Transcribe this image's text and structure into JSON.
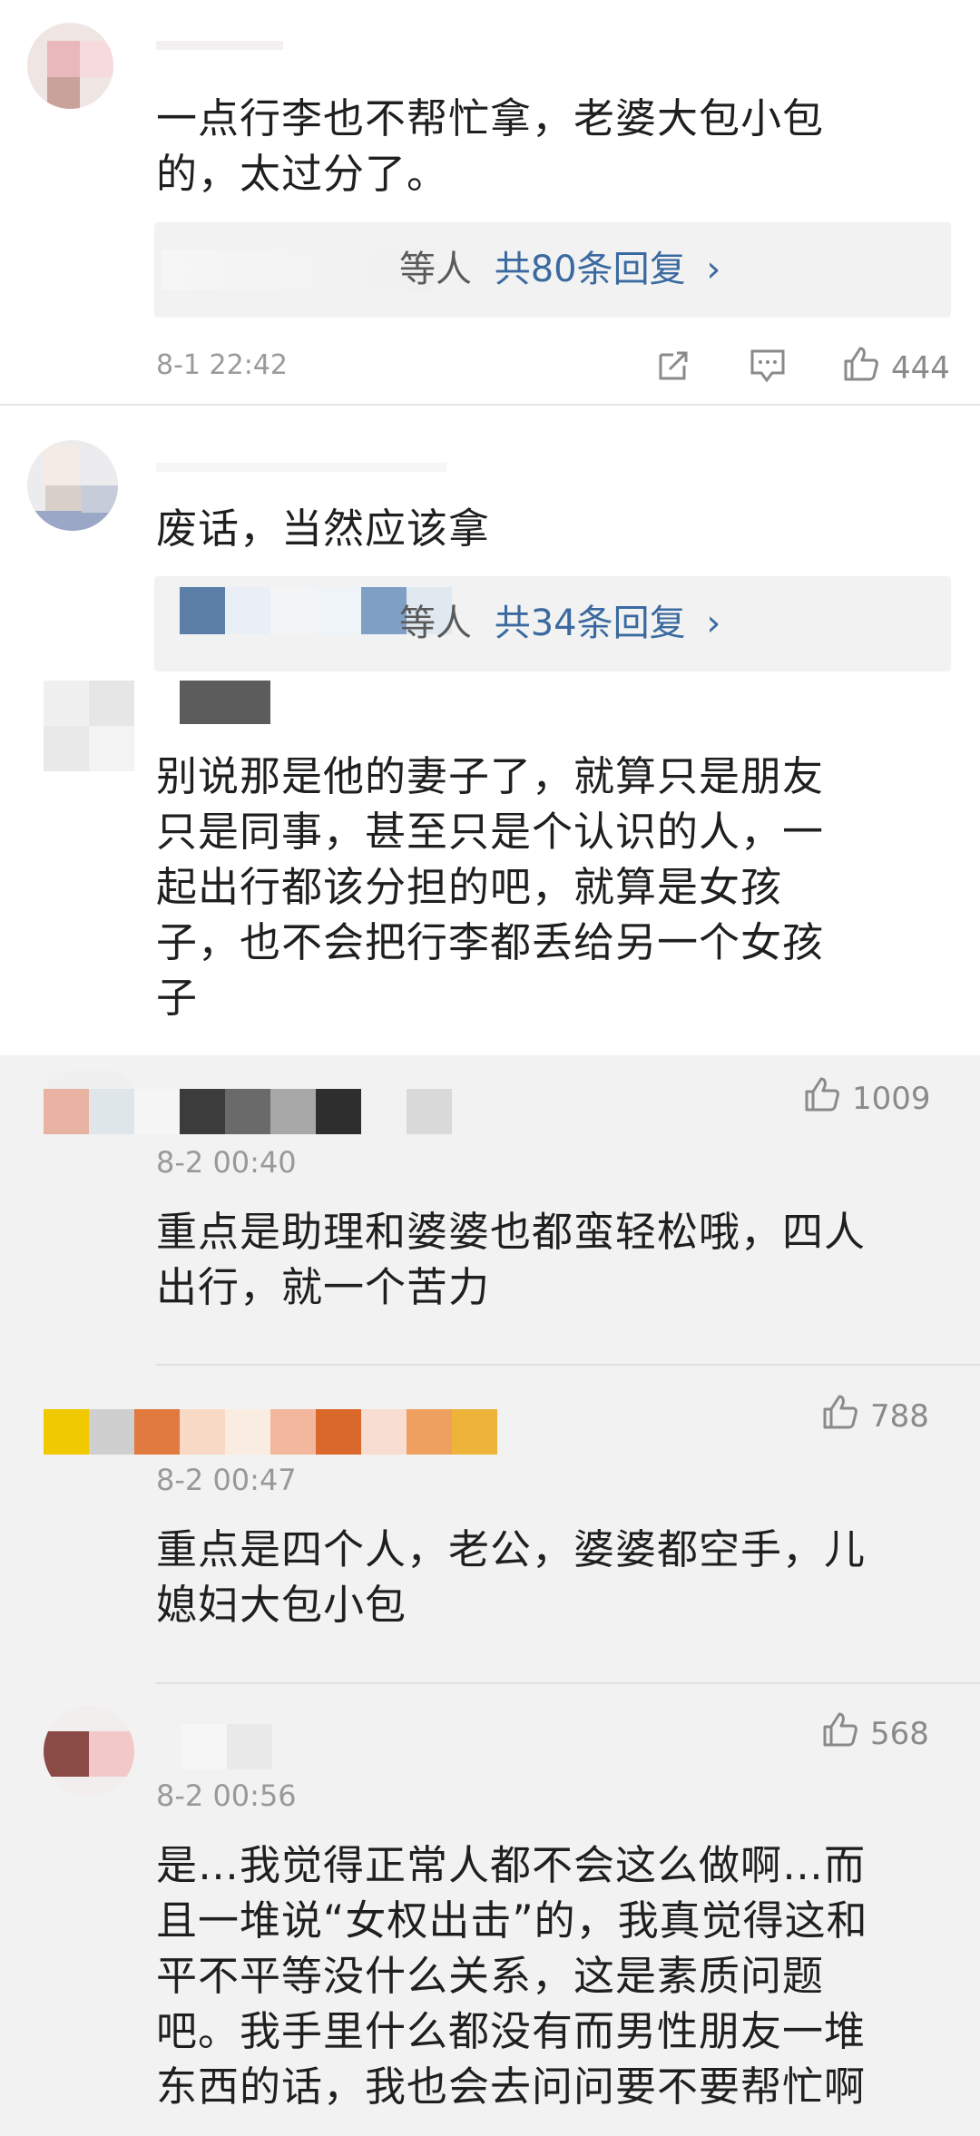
{
  "comments": [
    {
      "text": "一点行李也不帮忙拿，老婆大包小包\n的，太过分了。",
      "reply_prefix": "等人",
      "reply_link": "共80条回复",
      "reply_chevron": "›",
      "time": "8-1 22:42",
      "likes": "444",
      "icons": [
        "share-icon",
        "comment-icon",
        "thumbs-up-icon"
      ]
    },
    {
      "text": "废话，当然应该拿",
      "reply_prefix": "等人",
      "reply_link": "共34条回复",
      "reply_chevron": "›"
    },
    {
      "text": "别说那是他的妻子了，就算只是朋友\n只是同事，甚至只是个认识的人，一\n起出行都该分担的吧，就算是女孩\n子，也不会把行李都丢给另一个女孩\n子"
    }
  ],
  "replies": [
    {
      "time": "8-2 00:40",
      "likes": "1009",
      "text": "重点是助理和婆婆也都蛮轻松哦，四人\n出行，就一个苦力",
      "icons": [
        "thumbs-up-icon"
      ]
    },
    {
      "time": "8-2 00:47",
      "likes": "788",
      "text": "重点是四个人，老公，婆婆都空手，儿\n媳妇大包小包",
      "icons": [
        "thumbs-up-icon"
      ]
    },
    {
      "time": "8-2 00:56",
      "likes": "568",
      "text": "是…我觉得正常人都不会这么做啊…而\n且一堆说“女权出击”的，我真觉得这和\n平不平等没什么关系，这是素质问题\n吧。我手里什么都没有而男性朋友一堆\n东西的话，我也会去问问要不要帮忙啊",
      "icons": [
        "thumbs-up-icon"
      ]
    }
  ]
}
